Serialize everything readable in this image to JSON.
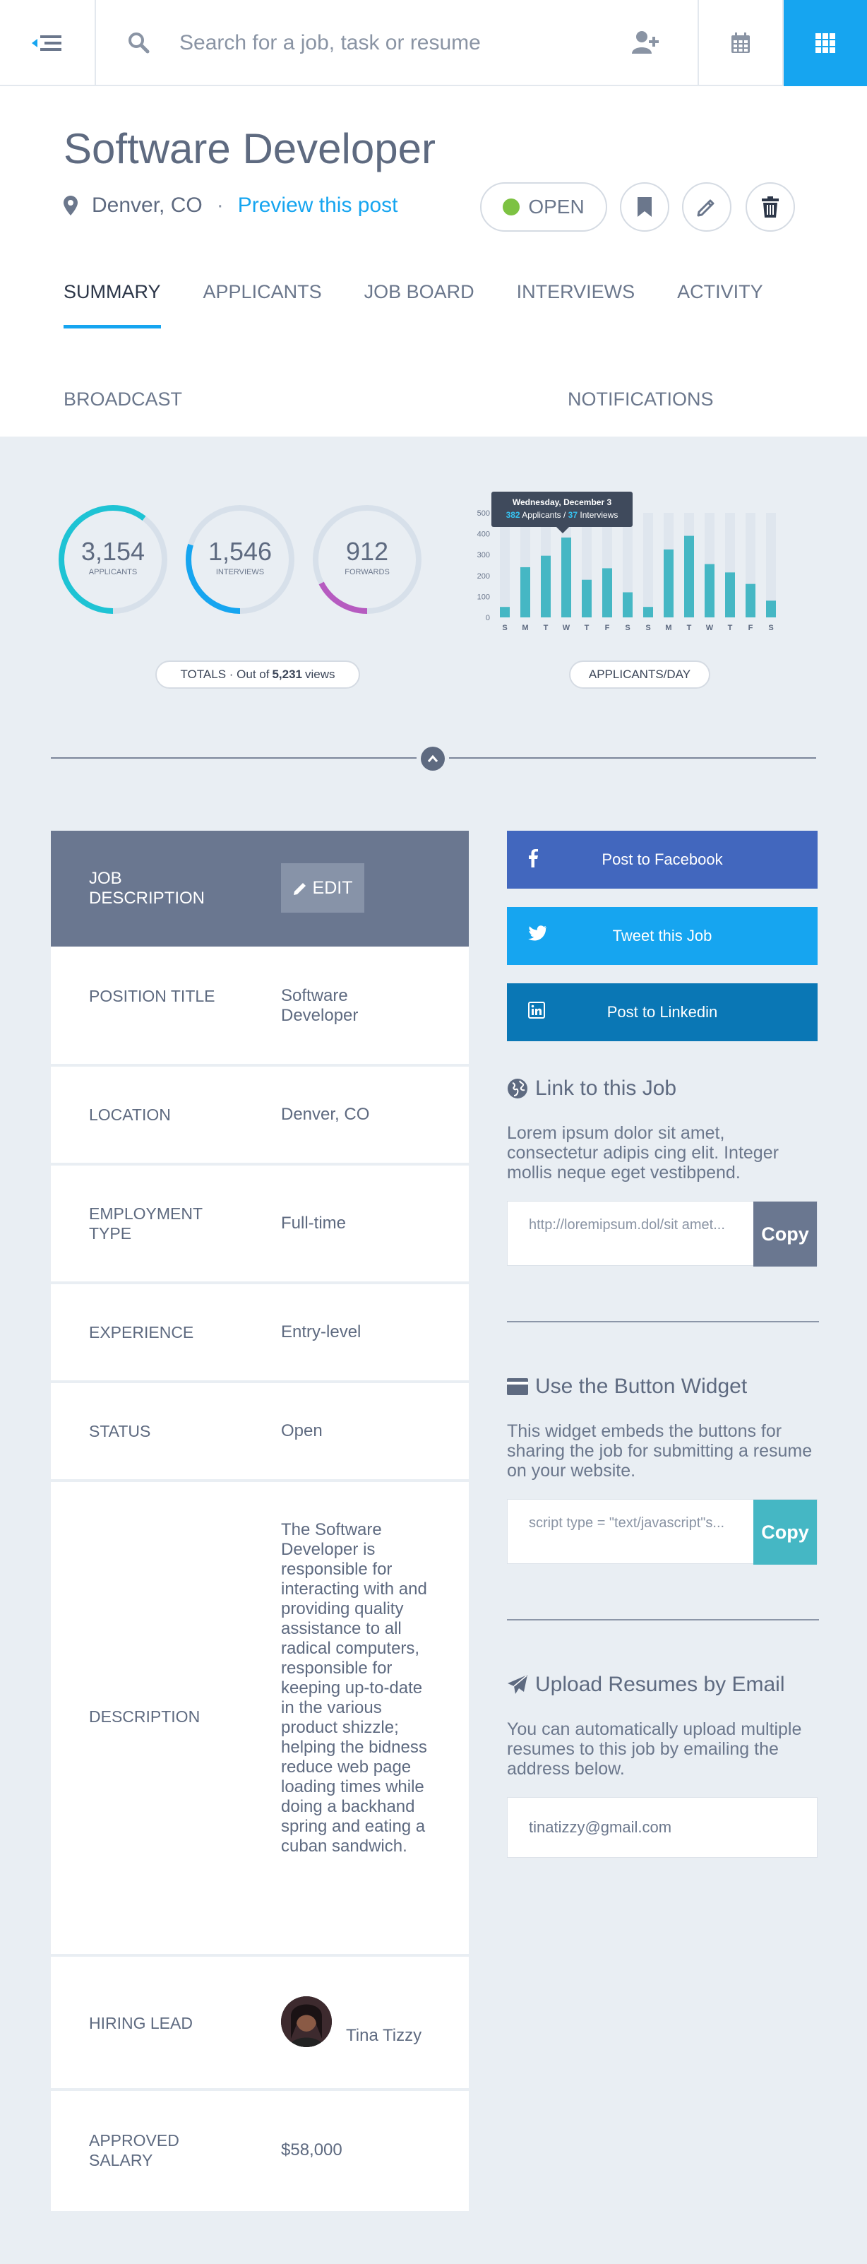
{
  "topbar": {
    "search_placeholder": "Search for a job, task or resume",
    "icons": [
      "menu-back-icon",
      "search-icon",
      "add-user-icon",
      "calendar-icon",
      "grid-icon"
    ]
  },
  "job": {
    "title": "Software Developer",
    "location": "Denver, CO",
    "separator": "·",
    "preview_link": "Preview this post",
    "status_badge": "OPEN"
  },
  "tabs": [
    "SUMMARY",
    "APPLICANTS",
    "JOB BOARD",
    "INTERVIEWS",
    "ACTIVITY"
  ],
  "subtabs": [
    "BROADCAST",
    "NOTIFICATIONS"
  ],
  "stats": {
    "rings": [
      {
        "value": "3,154",
        "label": "APPLICANTS",
        "fraction": 0.603,
        "color": "#1ec3d4"
      },
      {
        "value": "1,546",
        "label": "INTERVIEWS",
        "fraction": 0.296,
        "color": "#16a5f0"
      },
      {
        "value": "912",
        "label": "FORWARDS",
        "fraction": 0.174,
        "color": "#b65bc0"
      }
    ],
    "totals_prefix": "TOTALS · Out of",
    "totals_value": "5,231",
    "totals_suffix": "views",
    "chart_pill": "APPLICANTS/DAY"
  },
  "chart_data": {
    "type": "bar",
    "categories": [
      "S",
      "M",
      "T",
      "W",
      "T",
      "F",
      "S",
      "S",
      "M",
      "T",
      "W",
      "T",
      "F",
      "S"
    ],
    "values": [
      50,
      240,
      295,
      382,
      180,
      235,
      120,
      50,
      325,
      390,
      255,
      215,
      160,
      80
    ],
    "ylim": [
      0,
      500
    ],
    "yticks": [
      0,
      100,
      200,
      300,
      400,
      500
    ],
    "background_bar": 500,
    "tooltip": {
      "date": "Wednesday, December 3",
      "applicants": "382",
      "applicants_label": "Applicants /",
      "interviews": "37",
      "interviews_label": "Interviews"
    },
    "grid": false
  },
  "job_table": {
    "header": "JOB DESCRIPTION",
    "edit_label": "EDIT",
    "rows": [
      {
        "key": "POSITION TITLE",
        "value": "Software Developer"
      },
      {
        "key": "LOCATION",
        "value": "Denver, CO"
      },
      {
        "key": "EMPLOYMENT TYPE",
        "value": "Full-time"
      },
      {
        "key": "EXPERIENCE",
        "value": "Entry-level"
      },
      {
        "key": "STATUS",
        "value": "Open"
      },
      {
        "key": "DESCRIPTION",
        "value": "The Software Developer is responsible for interacting with and providing quality assistance to all radical computers, responsible for keeping up-to-date in the various product shizzle; helping the bidness reduce web page loading times while doing a backhand spring and eating a cuban sandwich."
      },
      {
        "key": "HIRING LEAD",
        "value": "Tina Tizzy"
      },
      {
        "key": "APPROVED SALARY",
        "value": "$58,000"
      }
    ]
  },
  "share": {
    "facebook": "Post to Facebook",
    "twitter": "Tweet this Job",
    "linkedin": "Post to Linkedin"
  },
  "link_section": {
    "title": "Link to this Job",
    "text": "Lorem ipsum dolor sit amet, consectetur adipis cing elit. Integer mollis neque eget vestibpend.",
    "code": "http://loremipsum.dol/sit amet...",
    "copy": "Copy",
    "copy_color": "#6a7790"
  },
  "widget_section": {
    "title": "Use the Button Widget",
    "text": "This widget embeds the buttons for sharing the job for submitting a resume on your website.",
    "code": "script type = \"text/javascript\"s...",
    "copy": "Copy",
    "copy_color": "#45b7c4"
  },
  "email_section": {
    "title": "Upload Resumes by Email",
    "text": "You can automatically upload multiple resumes to this job by emailing the address below.",
    "email": "tinatizzy@gmail.com"
  }
}
